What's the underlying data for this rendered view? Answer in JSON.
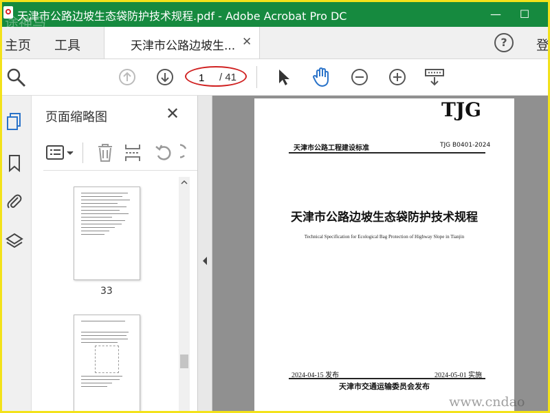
{
  "window": {
    "title": "天津市公路边坡生态袋防护技术规程.pdf - Adobe Acrobat Pro DC",
    "minimize": "—",
    "maximize": "☐",
    "watermark_topleft": "途神马"
  },
  "menu": {
    "home": "主页",
    "tools": "工具",
    "doc_tab": "天津市公路边坡生...",
    "doc_tab_close": "✕",
    "help": "?",
    "login": "登"
  },
  "toolbar": {
    "current_page": "1",
    "total_pages": "/ 41"
  },
  "panel": {
    "title": "页面缩略图",
    "close": "✕",
    "thumb1_label": "33"
  },
  "document": {
    "logo": "TJG",
    "category": "天津市公路工程建设标准",
    "code": "TJG B0401-2024",
    "title_cn": "天津市公路边坡生态袋防护技术规程",
    "title_en": "Technical Specification for Ecological Bag Protection of Highway Slope in Tianjin",
    "issue_date": "2024-04-15 发布",
    "implement_date": "2024-05-01 实施",
    "issuer": "天津市交通运输委员会发布"
  },
  "watermark_bottomright": "www.cndao",
  "colors": {
    "titlebar": "#168a3f",
    "border": "#f3e21a",
    "annotation": "#d02020",
    "hand_tool": "#2a73c9"
  }
}
